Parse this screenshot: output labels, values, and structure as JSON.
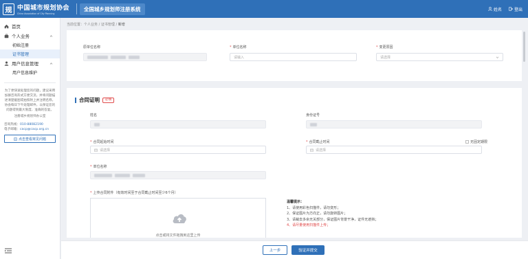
{
  "header": {
    "logo_mark": "规",
    "org_name_cn": "中国城市规划协会",
    "org_name_en": "China Association of City Planning",
    "system_title": "全国城乡规划师注册系统",
    "user_label": "姓名",
    "logout_label": "登出"
  },
  "sidebar": {
    "home": "首页",
    "personal_business": "个人业务",
    "initial_registration": "初始注册",
    "certificate_management": "证书管理",
    "user_info_management": "用户信息管理",
    "user_info_maintenance": "用户信息维护",
    "notice": "为了更快速处理您的问题，建议采用加群咨询形式方便交流，并将问题描述清楚截图或拍照附上并注明名称，协会每日下午处理邮件，以保证您的问题得到最大限度、准确的答复。",
    "notice_sign": "注册城乡规划师办公室",
    "phone_label": "咨询热线：",
    "phone_value": "010-88082190",
    "email_label": "电子邮箱：",
    "email_value": "cacp@cacp.org.cn",
    "faq_button": "点击查看常见问题"
  },
  "breadcrumb": {
    "prefix": "当前位置：",
    "level1": "个人业务",
    "sep": "/",
    "level2": "证书管理",
    "current": "新增"
  },
  "card1": {
    "org_label": "原单位名称",
    "unit_label": "单位名称",
    "unit_placeholder": "请输入",
    "reason_label": "变更原因",
    "reason_placeholder": "请选择"
  },
  "contract": {
    "title": "合同证明",
    "badge": "必填",
    "name_label": "姓名",
    "id_label": "身份证号",
    "start_label": "合同起始时间",
    "start_placeholder": "请选择",
    "end_label": "合同截止时间",
    "end_placeholder": "请选择",
    "no_fixed_label": "无固定期限",
    "unit_label": "单位名称",
    "upload_label": "上传合同附件（有效时间至于合同截止时间至少6个月）",
    "upload_hint": "点击或将文件拖拽到这里上传",
    "tips_title": "温馨提示：",
    "tips": [
      "1、请使用彩色扫描件，请勿变形；",
      "2、保证图片为方向正，请勿旋转图片；",
      "3、请裁去多余无关部分，保证图片背景干净，证件无遮挡；",
      "4、请尽量使用扫描件上传；"
    ]
  },
  "footer": {
    "prev_button": "上一步",
    "submit_button": "验证并提交"
  },
  "colors": {
    "primary": "#2f70b8",
    "required": "#e04a4a"
  }
}
